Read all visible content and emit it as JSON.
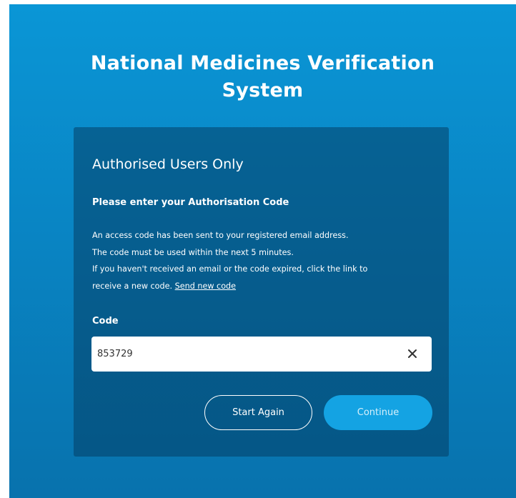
{
  "header": {
    "title_line1": "National Medicines Verification",
    "title_line2": "System"
  },
  "card": {
    "heading": "Authorised Users Only",
    "subheading": "Please enter your Authorisation Code",
    "info_line1": "An access code has been sent to your registered email address.",
    "info_line2": "The code must be used within the next 5 minutes.",
    "info_line3": "If you haven't received an email or the code expired, click the link to",
    "info_line4": "receive a new code.",
    "resend_link": "Send new code",
    "code_label": "Code",
    "code_value": "853729",
    "clear_icon": "close-icon",
    "start_again_label": "Start Again",
    "continue_label": "Continue"
  },
  "colors": {
    "background_top": "#0a96d6",
    "background_bottom": "#0872ad",
    "continue_button": "#14a3e3"
  }
}
